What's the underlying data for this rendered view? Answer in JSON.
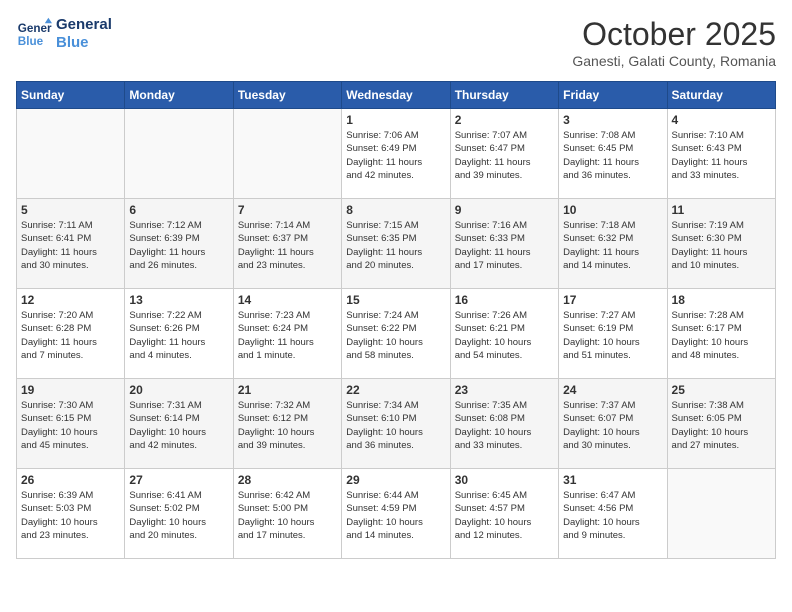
{
  "header": {
    "logo_line1": "General",
    "logo_line2": "Blue",
    "month": "October 2025",
    "location": "Ganesti, Galati County, Romania"
  },
  "weekdays": [
    "Sunday",
    "Monday",
    "Tuesday",
    "Wednesday",
    "Thursday",
    "Friday",
    "Saturday"
  ],
  "weeks": [
    [
      {
        "day": "",
        "info": ""
      },
      {
        "day": "",
        "info": ""
      },
      {
        "day": "",
        "info": ""
      },
      {
        "day": "1",
        "info": "Sunrise: 7:06 AM\nSunset: 6:49 PM\nDaylight: 11 hours\nand 42 minutes."
      },
      {
        "day": "2",
        "info": "Sunrise: 7:07 AM\nSunset: 6:47 PM\nDaylight: 11 hours\nand 39 minutes."
      },
      {
        "day": "3",
        "info": "Sunrise: 7:08 AM\nSunset: 6:45 PM\nDaylight: 11 hours\nand 36 minutes."
      },
      {
        "day": "4",
        "info": "Sunrise: 7:10 AM\nSunset: 6:43 PM\nDaylight: 11 hours\nand 33 minutes."
      }
    ],
    [
      {
        "day": "5",
        "info": "Sunrise: 7:11 AM\nSunset: 6:41 PM\nDaylight: 11 hours\nand 30 minutes."
      },
      {
        "day": "6",
        "info": "Sunrise: 7:12 AM\nSunset: 6:39 PM\nDaylight: 11 hours\nand 26 minutes."
      },
      {
        "day": "7",
        "info": "Sunrise: 7:14 AM\nSunset: 6:37 PM\nDaylight: 11 hours\nand 23 minutes."
      },
      {
        "day": "8",
        "info": "Sunrise: 7:15 AM\nSunset: 6:35 PM\nDaylight: 11 hours\nand 20 minutes."
      },
      {
        "day": "9",
        "info": "Sunrise: 7:16 AM\nSunset: 6:33 PM\nDaylight: 11 hours\nand 17 minutes."
      },
      {
        "day": "10",
        "info": "Sunrise: 7:18 AM\nSunset: 6:32 PM\nDaylight: 11 hours\nand 14 minutes."
      },
      {
        "day": "11",
        "info": "Sunrise: 7:19 AM\nSunset: 6:30 PM\nDaylight: 11 hours\nand 10 minutes."
      }
    ],
    [
      {
        "day": "12",
        "info": "Sunrise: 7:20 AM\nSunset: 6:28 PM\nDaylight: 11 hours\nand 7 minutes."
      },
      {
        "day": "13",
        "info": "Sunrise: 7:22 AM\nSunset: 6:26 PM\nDaylight: 11 hours\nand 4 minutes."
      },
      {
        "day": "14",
        "info": "Sunrise: 7:23 AM\nSunset: 6:24 PM\nDaylight: 11 hours\nand 1 minute."
      },
      {
        "day": "15",
        "info": "Sunrise: 7:24 AM\nSunset: 6:22 PM\nDaylight: 10 hours\nand 58 minutes."
      },
      {
        "day": "16",
        "info": "Sunrise: 7:26 AM\nSunset: 6:21 PM\nDaylight: 10 hours\nand 54 minutes."
      },
      {
        "day": "17",
        "info": "Sunrise: 7:27 AM\nSunset: 6:19 PM\nDaylight: 10 hours\nand 51 minutes."
      },
      {
        "day": "18",
        "info": "Sunrise: 7:28 AM\nSunset: 6:17 PM\nDaylight: 10 hours\nand 48 minutes."
      }
    ],
    [
      {
        "day": "19",
        "info": "Sunrise: 7:30 AM\nSunset: 6:15 PM\nDaylight: 10 hours\nand 45 minutes."
      },
      {
        "day": "20",
        "info": "Sunrise: 7:31 AM\nSunset: 6:14 PM\nDaylight: 10 hours\nand 42 minutes."
      },
      {
        "day": "21",
        "info": "Sunrise: 7:32 AM\nSunset: 6:12 PM\nDaylight: 10 hours\nand 39 minutes."
      },
      {
        "day": "22",
        "info": "Sunrise: 7:34 AM\nSunset: 6:10 PM\nDaylight: 10 hours\nand 36 minutes."
      },
      {
        "day": "23",
        "info": "Sunrise: 7:35 AM\nSunset: 6:08 PM\nDaylight: 10 hours\nand 33 minutes."
      },
      {
        "day": "24",
        "info": "Sunrise: 7:37 AM\nSunset: 6:07 PM\nDaylight: 10 hours\nand 30 minutes."
      },
      {
        "day": "25",
        "info": "Sunrise: 7:38 AM\nSunset: 6:05 PM\nDaylight: 10 hours\nand 27 minutes."
      }
    ],
    [
      {
        "day": "26",
        "info": "Sunrise: 6:39 AM\nSunset: 5:03 PM\nDaylight: 10 hours\nand 23 minutes."
      },
      {
        "day": "27",
        "info": "Sunrise: 6:41 AM\nSunset: 5:02 PM\nDaylight: 10 hours\nand 20 minutes."
      },
      {
        "day": "28",
        "info": "Sunrise: 6:42 AM\nSunset: 5:00 PM\nDaylight: 10 hours\nand 17 minutes."
      },
      {
        "day": "29",
        "info": "Sunrise: 6:44 AM\nSunset: 4:59 PM\nDaylight: 10 hours\nand 14 minutes."
      },
      {
        "day": "30",
        "info": "Sunrise: 6:45 AM\nSunset: 4:57 PM\nDaylight: 10 hours\nand 12 minutes."
      },
      {
        "day": "31",
        "info": "Sunrise: 6:47 AM\nSunset: 4:56 PM\nDaylight: 10 hours\nand 9 minutes."
      },
      {
        "day": "",
        "info": ""
      }
    ]
  ]
}
